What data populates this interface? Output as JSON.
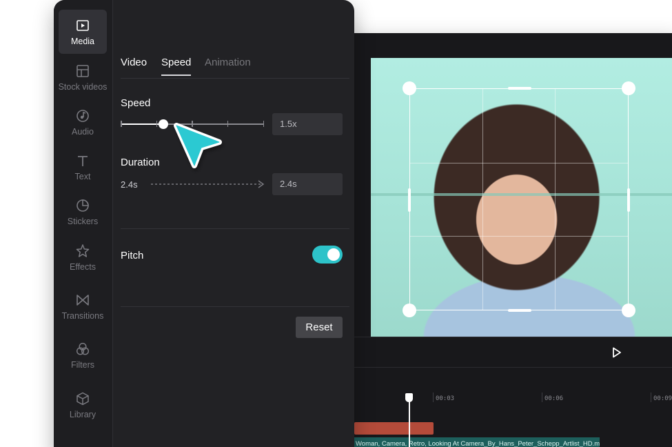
{
  "sidebar": {
    "items": [
      {
        "label": "Media",
        "icon": "media-icon",
        "active": true
      },
      {
        "label": "Stock videos",
        "icon": "stock-videos-icon"
      },
      {
        "label": "Audio",
        "icon": "audio-icon"
      },
      {
        "label": "Text",
        "icon": "text-icon"
      },
      {
        "label": "Stickers",
        "icon": "stickers-icon"
      },
      {
        "label": "Effects",
        "icon": "effects-icon"
      },
      {
        "label": "Transitions",
        "icon": "transitions-icon"
      },
      {
        "label": "Filters",
        "icon": "filters-icon"
      },
      {
        "label": "Library",
        "icon": "library-icon"
      }
    ]
  },
  "tabs": [
    {
      "label": "Video",
      "active": false
    },
    {
      "label": "Speed",
      "active": true
    },
    {
      "label": "Animation",
      "active": false
    }
  ],
  "speed": {
    "label": "Speed",
    "value": "1.5x",
    "slider_fraction": 0.3,
    "stops": 5
  },
  "duration": {
    "label": "Duration",
    "original": "2.4s",
    "new": "2.4s"
  },
  "pitch": {
    "label": "Pitch",
    "enabled": true
  },
  "reset_label": "Reset",
  "timeline": {
    "ticks": [
      "00:03",
      "00:06",
      "00:09"
    ],
    "clip_name": "Woman, Camera, Retro, Looking At Camera_By_Hans_Peter_Schepp_Artlist_HD.mp"
  },
  "colors": {
    "accent": "#2dc3c9",
    "panel": "#222225",
    "clip": "#b44b3a",
    "track": "#1d5f5c"
  }
}
